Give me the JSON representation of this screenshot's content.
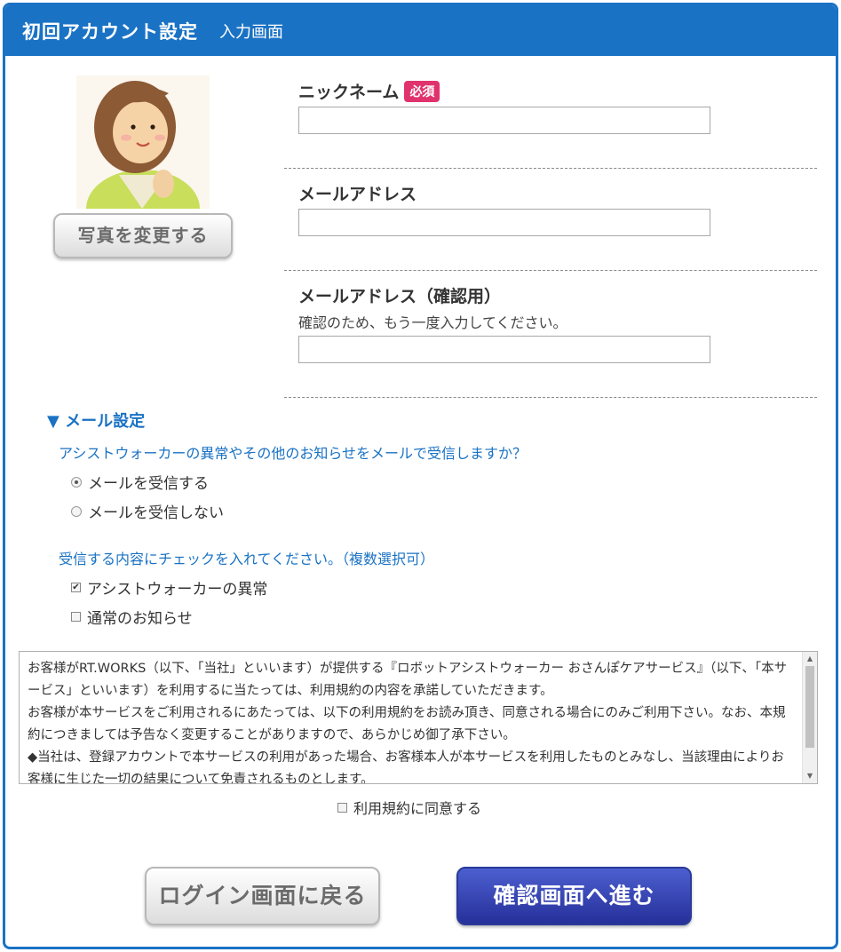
{
  "header": {
    "title": "初回アカウント設定",
    "subtitle": "入力画面"
  },
  "profile": {
    "change_photo_label": "写真を変更する"
  },
  "form": {
    "nickname": {
      "label": "ニックネーム",
      "badge": "必須",
      "value": ""
    },
    "email": {
      "label": "メールアドレス",
      "value": ""
    },
    "email_confirm": {
      "label": "メールアドレス（確認用）",
      "hint": "確認のため、もう一度入力してください。",
      "value": ""
    }
  },
  "mail_settings": {
    "title": "▼ メール設定",
    "receive_question": "アシストウォーカーの異常やその他のお知らせをメールで受信しますか？",
    "receive_options": [
      {
        "label": "メールを受信する",
        "selected": true
      },
      {
        "label": "メールを受信しない",
        "selected": false
      }
    ],
    "content_question": "受信する内容にチェックを入れてください。（複数選択可）",
    "content_options": [
      {
        "label": "アシストウォーカーの異常",
        "checked": true
      },
      {
        "label": "通常のお知らせ",
        "checked": false
      }
    ]
  },
  "terms": {
    "paragraphs": [
      "お客様がRT.WORKS（以下、「当社」といいます）が提供する『ロボットアシストウォーカー おさんぽケアサービス』（以下、「本サービス」といいます）を利用するに当たっては、利用規約の内容を承諾していただきます。",
      "お客様が本サービスをご利用されるにあたっては、以下の利用規約をお読み頂き、同意される場合にのみご利用下さい。なお、本規約につきましては予告なく変更することがありますので、あらかじめ御了承下さい。",
      "◆当社は、登録アカウントで本サービスの利用があった場合、お客様本人が本サービスを利用したものとみなし、当該理由によりお客様に生じた一切の結果について免責されるものとします。"
    ],
    "agree_label": "利用規約に同意する",
    "agree_checked": false
  },
  "actions": {
    "back_label": "ログイン画面に戻る",
    "next_label": "確認画面へ進む"
  },
  "colors": {
    "brand": "#1a72c4",
    "badge": "#e0336d",
    "primary_button": "#2f3ba8"
  }
}
